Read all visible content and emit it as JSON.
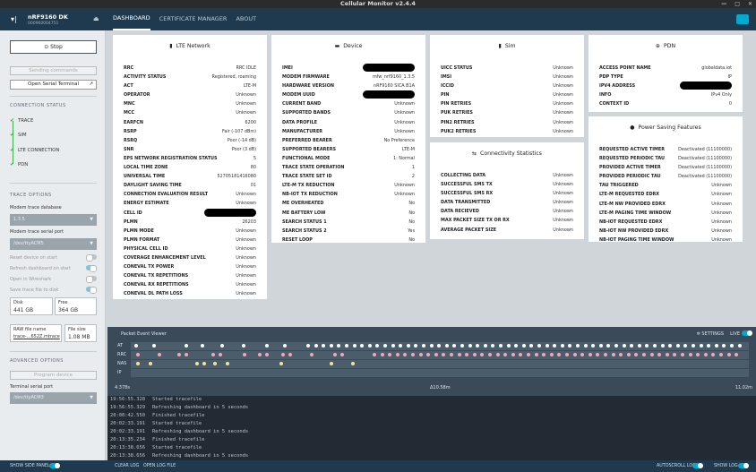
{
  "window": {
    "title": "Cellular Monitor v2.4.4"
  },
  "device": {
    "name": "nRF9160 DK",
    "serial": "000960004751"
  },
  "nav": {
    "tabs": [
      "DASHBOARD",
      "CERTIFICATE MANAGER",
      "ABOUT"
    ]
  },
  "sidebar": {
    "stop_label": "Stop",
    "sending_commands": "Sending commands",
    "open_serial_terminal": "Open Serial Terminal",
    "connection_status_title": "CONNECTION STATUS",
    "connection_items": [
      "TRACE",
      "SIM",
      "LTE CONNECTION",
      "PDN"
    ],
    "trace_options_title": "TRACE OPTIONS",
    "modem_trace_db_label": "Modem trace database",
    "modem_trace_db_value": "1.3.5",
    "modem_trace_port_label": "Modem trace serial port",
    "modem_trace_port_value": "/dev/ttyACM5",
    "toggles": [
      {
        "label": "Reset device on start",
        "on": false
      },
      {
        "label": "Refresh dashboard on start",
        "on": true
      },
      {
        "label": "Open in Wireshark",
        "on": false
      },
      {
        "label": "Save trace file to disk",
        "on": true
      }
    ],
    "disk_label": "Disk",
    "disk_value": "441 GB",
    "free_label": "Free",
    "free_value": "364 GB",
    "raw_file_label": "RAW file name",
    "raw_file_value": "trace-...652Z.mtrace",
    "file_size_label": "File size",
    "file_size_value": "1.08 MB",
    "advanced_title": "ADVANCED OPTIONS",
    "program_device": "Program device",
    "terminal_port_label": "Terminal serial port",
    "terminal_port_value": "/dev/ttyACM3",
    "show_side_panel": "SHOW SIDE PANEL"
  },
  "lte": {
    "title": "LTE Network",
    "rows": [
      [
        "RRC",
        "RRC IDLE"
      ],
      [
        "ACTIVITY STATUS",
        "Registered, roaming"
      ],
      [
        "ACT",
        "LTE-M"
      ],
      [
        "OPERATOR",
        "Unknown"
      ],
      [
        "MNC",
        "Unknown"
      ],
      [
        "MCC",
        "Unknown"
      ],
      [
        "EARFCN",
        "6200"
      ],
      [
        "RSRP",
        "Fair (-107 dBm)"
      ],
      [
        "RSRQ",
        "Poor (-14 dB)"
      ],
      [
        "SNR",
        "Poor (3 dB)"
      ],
      [
        "EPS NETWORK REGISTRATION STATUS",
        "5"
      ],
      [
        "LOCAL TIME ZONE",
        "80"
      ],
      [
        "UNIVERSAL TIME",
        "52705181416080"
      ],
      [
        "DAYLIGHT SAVING TIME",
        "01"
      ],
      [
        "CONNECTION EVALUATION RESULT",
        "Unknown"
      ],
      [
        "ENERGY ESTIMATE",
        "Unknown"
      ],
      [
        "CELL ID",
        ""
      ],
      [
        "PLMN",
        "26203"
      ],
      [
        "PLMN MODE",
        "Unknown"
      ],
      [
        "PLMN FORMAT",
        "Unknown"
      ],
      [
        "PHYSICAL CELL ID",
        "Unknown"
      ],
      [
        "COVERAGE ENHANCEMENT LEVEL",
        "Unknown"
      ],
      [
        "CONEVAL TX POWER",
        "Unknown"
      ],
      [
        "CONEVAL TX REPETITIONS",
        "Unknown"
      ],
      [
        "CONEVAL RX REPETITIONS",
        "Unknown"
      ],
      [
        "CONEVAL DL PATH LOSS",
        "Unknown"
      ]
    ]
  },
  "device_panel": {
    "title": "Device",
    "rows": [
      [
        "IMEI",
        ""
      ],
      [
        "MODEM FIRMWARE",
        "mfw_nrf9160_1.3.5"
      ],
      [
        "HARDWARE VERSION",
        "nRF9160 SICA B1A"
      ],
      [
        "MODEM UUID",
        ""
      ],
      [
        "CURRENT BAND",
        "Unknown"
      ],
      [
        "SUPPORTED BANDS",
        "Unknown"
      ],
      [
        "DATA PROFILE",
        "Unknown"
      ],
      [
        "MANUFACTURER",
        "Unknown"
      ],
      [
        "PREFERRED BEARER",
        "No Preference"
      ],
      [
        "SUPPORTED BEARERS",
        "LTE-M"
      ],
      [
        "FUNCTIONAL MODE",
        "1: Normal"
      ],
      [
        "TRACE STATE OPERATION",
        "1"
      ],
      [
        "TRACE STATE SET ID",
        "2"
      ],
      [
        "LTE-M TX REDUCTION",
        "Unknown"
      ],
      [
        "NB-IOT TX REDUCTION",
        "Unknown"
      ],
      [
        "ME OVERHEATED",
        "No"
      ],
      [
        "ME BATTERY LOW",
        "No"
      ],
      [
        "SEARCH STATUS 1",
        "No"
      ],
      [
        "SEARCH STATUS 2",
        "Yes"
      ],
      [
        "RESET LOOP",
        "No"
      ]
    ]
  },
  "sim": {
    "title": "Sim",
    "rows": [
      [
        "UICC STATUS",
        "Unknown"
      ],
      [
        "IMSI",
        "Unknown"
      ],
      [
        "ICCID",
        "Unknown"
      ],
      [
        "PIN",
        "Unknown"
      ],
      [
        "PIN RETRIES",
        "Unknown"
      ],
      [
        "PUK RETRIES",
        "Unknown"
      ],
      [
        "PIN2 RETRIES",
        "Unknown"
      ],
      [
        "PUK2 RETRIES",
        "Unknown"
      ]
    ]
  },
  "connectivity": {
    "title": "Connectivity Statistics",
    "rows": [
      [
        "COLLECTING DATA",
        "Unknown"
      ],
      [
        "SUCCESSFUL SMS TX",
        "Unknown"
      ],
      [
        "SUCCESSFUL SMS RX",
        "Unknown"
      ],
      [
        "DATA TRANSMITTED",
        "Unknown"
      ],
      [
        "DATA RECIEVED",
        "Unknown"
      ],
      [
        "MAX PACKET SIZE TX OR RX",
        "Unknown"
      ],
      [
        "AVERAGE PACKET SIZE",
        "Unknown"
      ]
    ]
  },
  "pdn": {
    "title": "PDN",
    "rows": [
      [
        "ACCESS POINT NAME",
        "globaldata.iot"
      ],
      [
        "PDP TYPE",
        "IP"
      ],
      [
        "IPV4 ADDRESS",
        ""
      ],
      [
        "INFO",
        "IPv4 Only"
      ],
      [
        "CONTEXT ID",
        "0"
      ]
    ]
  },
  "psm": {
    "title": "Power Saving Features",
    "rows": [
      [
        "REQUESTED ACTIVE TIMER",
        "Deactivated (11100000)"
      ],
      [
        "REQUESTED PERIODIC TAU",
        "Deactivated (11100000)"
      ],
      [
        "PROVIDED ACTIVE TIMER",
        "Deactivated (11100000)"
      ],
      [
        "PROVIDED PERIODIC TAU",
        "Deactivated (11100000)"
      ],
      [
        "TAU TRIGGERED",
        "Unknown"
      ],
      [
        "LTE-M REQUESTED EDRX",
        "Unknown"
      ],
      [
        "LTE-M NW PROVIDED EDRX",
        "Unknown"
      ],
      [
        "LTE-M PAGING TIME WINDOW",
        "Unknown"
      ],
      [
        "NB-IOT REQUESTED EDRX",
        "Unknown"
      ],
      [
        "NB-IOT NW PROVIDED EDRX",
        "Unknown"
      ],
      [
        "NB-IOT PAGING TIME WINDOW",
        "Unknown"
      ]
    ]
  },
  "packet_viewer": {
    "title": "Packet Event Viewer",
    "settings": "SETTINGS",
    "live": "LIVE",
    "lanes": [
      "AT",
      "RRC",
      "NAS",
      "IP"
    ],
    "time_start": "4.378s",
    "time_mid": "Δ10.58m",
    "time_end": "11.02m",
    "colors": {
      "AT": "#ffffff",
      "RRC": "#f2a7b8",
      "NAS": "#f5e39a",
      "IP": "#8fd0e0"
    }
  },
  "log": {
    "lines": [
      [
        "19:56:55.328",
        "Started tracefile"
      ],
      [
        "19:56:55.329",
        "Refreshing dashboard in 5 seconds"
      ],
      [
        "20:00:42.550",
        "Finished tracefile"
      ],
      [
        "20:02:33.191",
        "Started tracefile"
      ],
      [
        "20:02:33.191",
        "Refreshing dashboard in 5 seconds"
      ],
      [
        "20:13:35.234",
        "Finished tracefile"
      ],
      [
        "20:13:38.656",
        "Started tracefile"
      ],
      [
        "20:13:38.656",
        "Refreshing dashboard in 5 seconds"
      ]
    ]
  },
  "bottom": {
    "clear_log": "CLEAR LOG",
    "open_log_file": "OPEN LOG FILE",
    "autoscroll_log": "AUTOSCROLL LOG",
    "show_log": "SHOW LOG"
  }
}
